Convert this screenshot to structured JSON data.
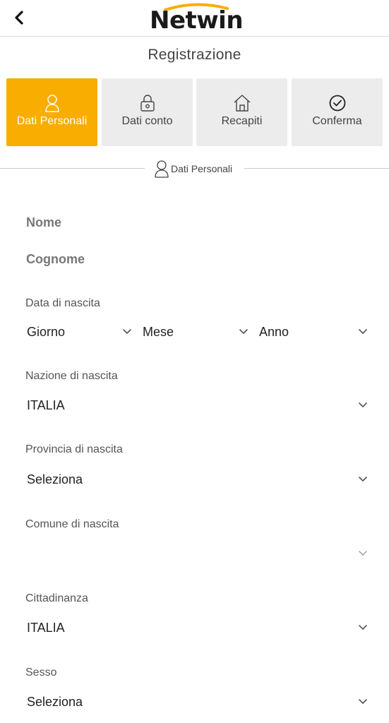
{
  "header": {
    "back_icon": "chevron-left-icon",
    "logo_text": "Netwin",
    "logo_accent": "#f9ad00"
  },
  "page": {
    "title": "Registrazione"
  },
  "steps": [
    {
      "label": "Dati Personali",
      "icon": "user-icon",
      "active": true
    },
    {
      "label": "Dati conto",
      "icon": "lock-icon",
      "active": false
    },
    {
      "label": "Recapiti",
      "icon": "home-icon",
      "active": false
    },
    {
      "label": "Conferma",
      "icon": "check-circle-icon",
      "active": false
    }
  ],
  "section": {
    "title": "Dati Personali",
    "icon": "user-icon"
  },
  "form": {
    "nome_placeholder": "Nome",
    "cognome_placeholder": "Cognome",
    "data_label": "Data di nascita",
    "giorno": "Giorno",
    "mese": "Mese",
    "anno": "Anno",
    "nazione_label": "Nazione di nascita",
    "nazione_value": "ITALIA",
    "provincia_label": "Provincia di nascita",
    "provincia_value": "Seleziona",
    "comune_label": "Comune di nascita",
    "comune_value": "",
    "cittadinanza_label": "Cittadinanza",
    "cittadinanza_value": "ITALIA",
    "sesso_label": "Sesso",
    "sesso_value": "Seleziona"
  },
  "colors": {
    "accent": "#f9ad00",
    "step_inactive_bg": "#ececec"
  }
}
